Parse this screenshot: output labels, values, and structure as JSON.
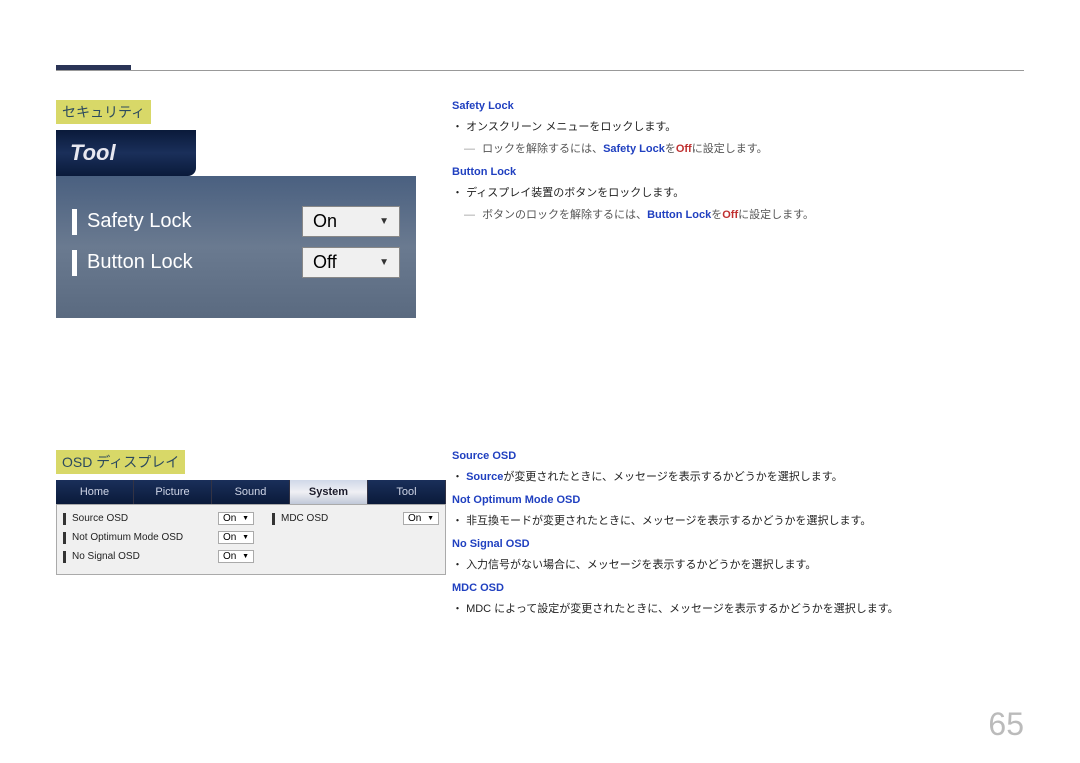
{
  "sections": {
    "security": {
      "title": "セキュリティ"
    },
    "osd": {
      "title": "OSD ディスプレイ"
    }
  },
  "tool_panel": {
    "header": "Tool",
    "rows": [
      {
        "label": "Safety Lock",
        "value": "On"
      },
      {
        "label": "Button Lock",
        "value": "Off"
      }
    ]
  },
  "osd_panel": {
    "tabs": [
      "Home",
      "Picture",
      "Sound",
      "System",
      "Tool"
    ],
    "active_tab": "System",
    "rows_left": [
      {
        "label": "Source OSD",
        "value": "On"
      },
      {
        "label": "Not Optimum Mode OSD",
        "value": "On"
      },
      {
        "label": "No Signal OSD",
        "value": "On"
      }
    ],
    "rows_right": [
      {
        "label": "MDC OSD",
        "value": "On"
      }
    ]
  },
  "desc_security": {
    "safety_lock": {
      "head": "Safety Lock",
      "bullet": "オンスクリーン メニューをロックします。",
      "note_pre": "ロックを解除するには、",
      "note_hl1": "Safety Lock",
      "note_mid": "を",
      "note_hl2": "Off",
      "note_post": "に設定します。"
    },
    "button_lock": {
      "head": "Button Lock",
      "bullet": "ディスプレイ装置のボタンをロックします。",
      "note_pre": "ボタンのロックを解除するには、",
      "note_hl1": "Button Lock",
      "note_mid": "を",
      "note_hl2": "Off",
      "note_post": "に設定します。"
    }
  },
  "desc_osd": {
    "source_osd": {
      "head": "Source OSD",
      "bullet_hl": "Source",
      "bullet_post": "が変更されたときに、メッセージを表示するかどうかを選択します。"
    },
    "not_optimum": {
      "head": "Not Optimum Mode OSD",
      "bullet": "非互換モードが変更されたときに、メッセージを表示するかどうかを選択します。"
    },
    "no_signal": {
      "head": "No Signal OSD",
      "bullet": "入力信号がない場合に、メッセージを表示するかどうかを選択します。"
    },
    "mdc": {
      "head": "MDC OSD",
      "bullet": "MDC によって設定が変更されたときに、メッセージを表示するかどうかを選択します。"
    }
  },
  "page_number": "65"
}
